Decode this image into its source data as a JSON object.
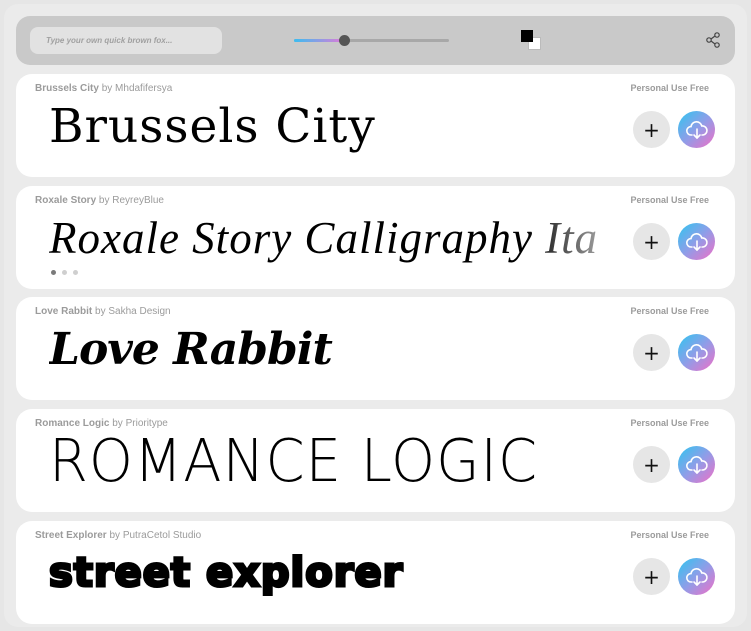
{
  "toolbar": {
    "search_placeholder": "Type your own quick brown fox...",
    "slider_value": 0.32,
    "accent_gradient": [
      "#3bbdf0",
      "#e07ad8"
    ]
  },
  "fonts": [
    {
      "name": "Brussels City",
      "by": "by",
      "author": "Mhdafifersya",
      "license": "Personal Use Free",
      "sample": "Brussels City"
    },
    {
      "name": "Roxale Story",
      "by": "by",
      "author": "ReyreyBlue",
      "license": "Personal Use Free",
      "sample": "Roxale Story Calligraphy Ita"
    },
    {
      "name": "Love Rabbit",
      "by": "by",
      "author": "Sakha Design",
      "license": "Personal Use Free",
      "sample": "Love Rabbit"
    },
    {
      "name": "Romance Logic",
      "by": "by",
      "author": "Prioritype",
      "license": "Personal Use Free",
      "sample": "ROMANCE LOGIC"
    },
    {
      "name": "Street Explorer",
      "by": "by",
      "author": "PutraCetol Studio",
      "license": "Personal Use Free",
      "sample": "street explorer"
    }
  ],
  "buttons": {
    "add": "+"
  },
  "icons": {
    "share": "share-icon",
    "download": "cloud-download-icon",
    "color": "color-swap-icon"
  },
  "colors": {
    "download_gradient": [
      "#2ec6f0",
      "#f06fc6"
    ],
    "card_bg": "#ffffff",
    "toolbar_bg": "#c9c9c9"
  }
}
